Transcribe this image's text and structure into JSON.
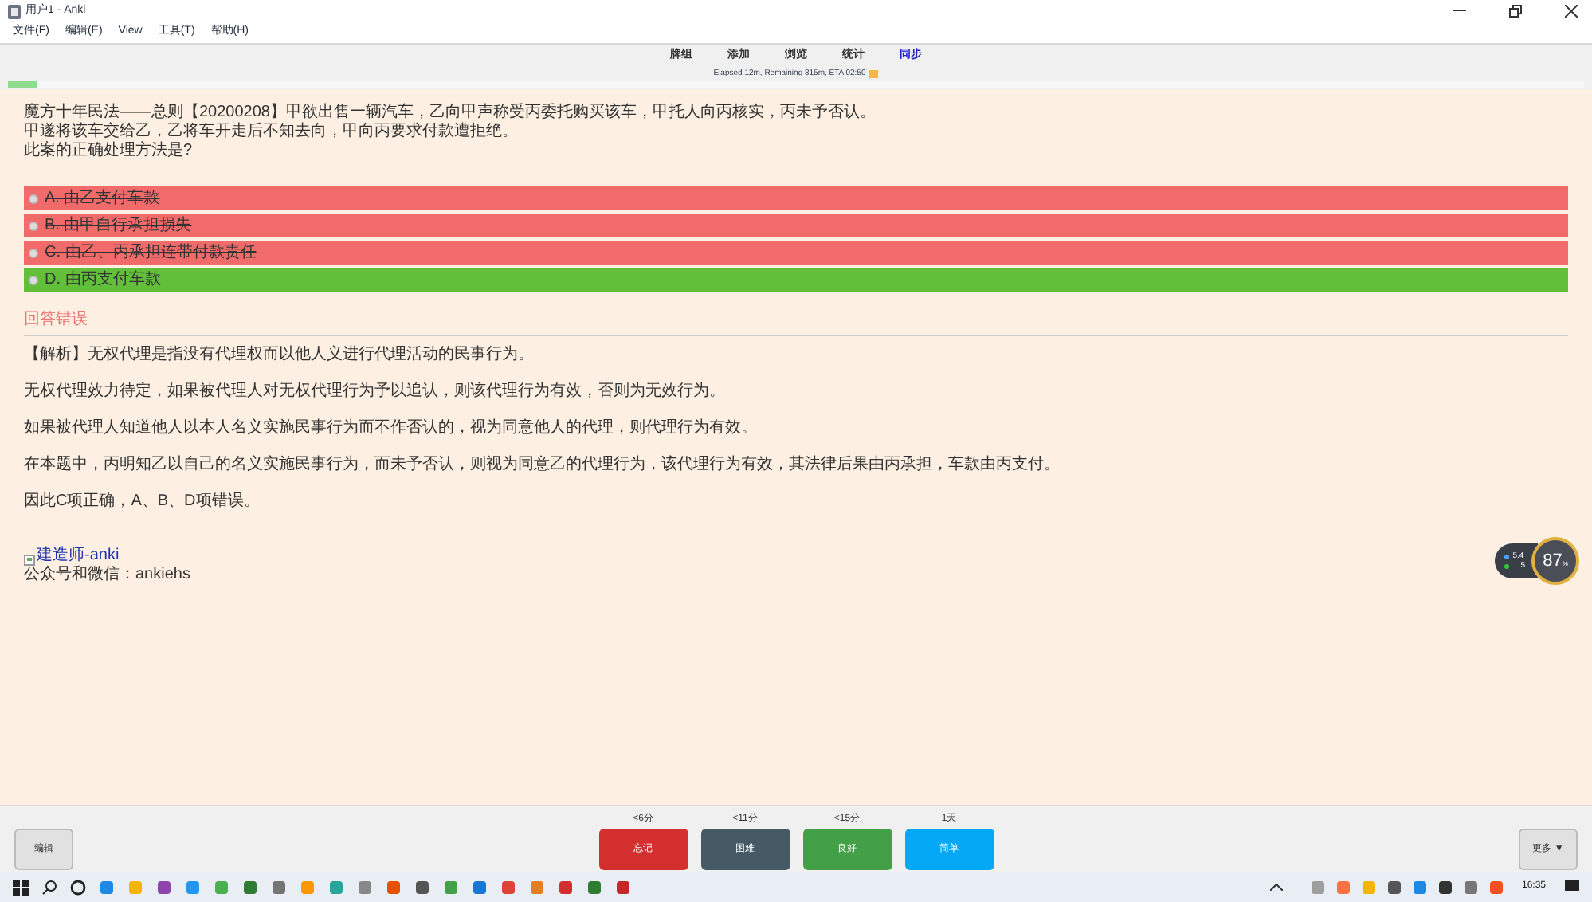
{
  "window": {
    "title": "用户1 - Anki"
  },
  "menu": [
    "文件(F)",
    "编辑(E)",
    "View",
    "工具(T)",
    "帮助(H)"
  ],
  "toolbar": [
    {
      "label": "牌组",
      "highlighted": false
    },
    {
      "label": "添加",
      "highlighted": false
    },
    {
      "label": "浏览",
      "highlighted": false
    },
    {
      "label": "统计",
      "highlighted": false
    },
    {
      "label": "同步",
      "highlighted": true
    }
  ],
  "timer": "Elapsed 12m, Remaining 815m, ETA 02:50",
  "progress": {
    "level": 0.018
  },
  "question": [
    "魔方十年民法——总则【20200208】甲欲出售一辆汽车，乙向甲声称受丙委托购买该车，甲托人向丙核实，丙未予否认。",
    "甲遂将该车交给乙，乙将车开走后不知去向，甲向丙要求付款遭拒绝。",
    "此案的正确处理方法是?"
  ],
  "options": [
    {
      "label": "A. 由乙支付车款",
      "correct": false
    },
    {
      "label": "B. 由甲自行承担损失",
      "correct": false
    },
    {
      "label": "C. 由乙、丙承担连带付款责任",
      "correct": false
    },
    {
      "label": "D. 由丙支付车款",
      "correct": true
    }
  ],
  "result": "回答错误",
  "explanation": [
    "【解析】无权代理是指没有代理权而以他人义进行代理活动的民事行为。",
    "无权代理效力待定，如果被代理人对无权代理行为予以追认，则该代理行为有效，否则为无效行为。",
    "如果被代理人知道他人以本人名义实施民事行为而不作否认的，视为同意他人的代理，则代理行为有效。",
    "在本题中，丙明知乙以自己的名义实施民事行为，而未予否认，则视为同意乙的代理行为，该代理行为有效，其法律后果由丙承担，车款由丙支付。",
    "因此C项正确，A、B、D项错误。"
  ],
  "image_alt": "建造师-anki",
  "footer_note": "公众号和微信：ankiehs",
  "speed_widget": {
    "upload": "5.4",
    "download": "5",
    "percent": "87",
    "unit": "%"
  },
  "edit_button": "编辑",
  "answer_buttons": [
    {
      "time": "<6分",
      "label": "忘记",
      "color": "#d32f2f"
    },
    {
      "time": "<11分",
      "label": "困难",
      "color": "#455a64"
    },
    {
      "time": "<15分",
      "label": "良好",
      "color": "#43a047"
    },
    {
      "time": "1天",
      "label": "简单",
      "color": "#03a9f4"
    }
  ],
  "more_button": "更多 ▼",
  "taskbar": {
    "time": "16:35"
  }
}
